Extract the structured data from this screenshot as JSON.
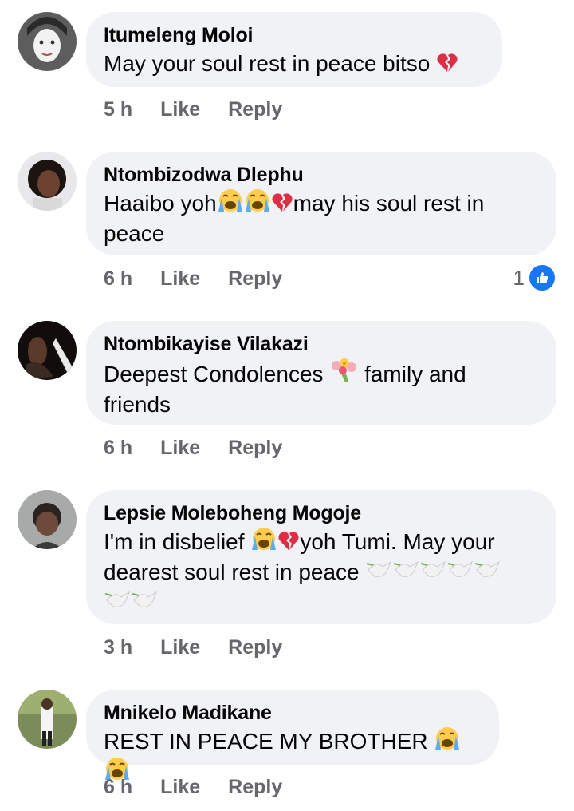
{
  "comments": [
    {
      "author": "Itumeleng Moloi",
      "text": "May your soul rest in peace bitso",
      "time": "5 h",
      "like": "Like",
      "reply": "Reply"
    },
    {
      "author": "Ntombizodwa Dlephu",
      "text_a": "Haaibo yoh",
      "text_b": "may his soul rest in",
      "text_c": "peace",
      "time": "6 h",
      "like": "Like",
      "reply": "Reply",
      "reaction_count": "1"
    },
    {
      "author": "Ntombikayise Vilakazi",
      "text_a": "Deepest Condolences",
      "text_b": "family and",
      "text_c": "friends",
      "time": "6 h",
      "like": "Like",
      "reply": "Reply"
    },
    {
      "author": "Lepsie Moleboheng Mogoje",
      "text_a": "I'm in disbelief",
      "text_b": "yoh Tumi. May your",
      "text_c": "dearest soul rest in peace",
      "time": "3 h",
      "like": "Like",
      "reply": "Reply"
    },
    {
      "author": "Mnikelo Madikane",
      "text": "REST IN PEACE MY BROTHER",
      "time": "6 h",
      "like": "Like",
      "reply": "Reply"
    }
  ],
  "icons": {
    "broken_heart": "broken-heart-icon",
    "crying_face": "loudly-crying-face-icon",
    "bouquet": "bouquet-icon",
    "dove": "dove-icon",
    "like_reaction": "thumbs-up-icon"
  },
  "colors": {
    "bubble": "#f0f2f5",
    "meta_text": "#65676b",
    "like_blue": "#1877f2",
    "heart_red": "#dd2e44",
    "emoji_yellow": "#ffcc4d"
  }
}
